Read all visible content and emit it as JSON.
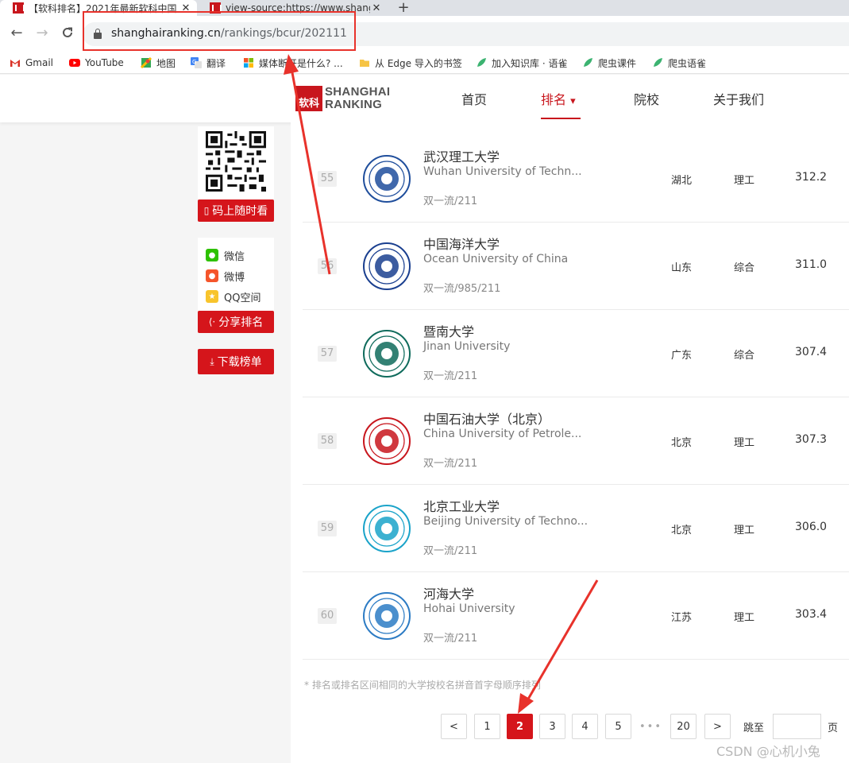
{
  "browser": {
    "tabs": [
      {
        "title": "【软科排名】2021年最新软科中国",
        "active": true
      },
      {
        "title": "view-source:https://www.shanghairanking.cn",
        "active": false
      }
    ],
    "new_tab_glyph": "+",
    "url_host": "shanghairanking.cn",
    "url_path": "/rankings/bcur/202111",
    "bookmarks": [
      "Gmail",
      "YouTube",
      "地图",
      "翻译",
      "媒体断开是什么? ...",
      "从 Edge 导入的书签",
      "加入知识库 · 语雀",
      "爬虫课件",
      "爬虫语雀"
    ]
  },
  "site": {
    "logo_mark": "软科",
    "logo_line1": "SHANGHAI",
    "logo_line2": "RANKING",
    "nav": [
      "首页",
      "排名",
      "院校",
      "关于我们"
    ],
    "nav_dropdown_glyph": "▾"
  },
  "sidebar": {
    "qr_button": "码上随时看",
    "share_items": [
      "微信",
      "微博",
      "QQ空间"
    ],
    "share_button": "分享排名",
    "download_button": "下载榜单"
  },
  "rankings": [
    {
      "rank": "55",
      "name_cn": "武汉理工大学",
      "name_en": "Wuhan University of Techn...",
      "tags": "双一流/211",
      "province": "湖北",
      "type": "理工",
      "score": "312.2",
      "emblem_color": "#1f4e9c"
    },
    {
      "rank": "56",
      "name_cn": "中国海洋大学",
      "name_en": "Ocean University of China",
      "tags": "双一流/985/211",
      "province": "山东",
      "type": "综合",
      "score": "311.0",
      "emblem_color": "#1a3f8f"
    },
    {
      "rank": "57",
      "name_cn": "暨南大学",
      "name_en": "Jinan University",
      "tags": "双一流/211",
      "province": "广东",
      "type": "综合",
      "score": "307.4",
      "emblem_color": "#0f6b5c"
    },
    {
      "rank": "58",
      "name_cn": "中国石油大学（北京）",
      "name_en": "China University of Petrole...",
      "tags": "双一流/211",
      "province": "北京",
      "type": "理工",
      "score": "307.3",
      "emblem_color": "#c8161d"
    },
    {
      "rank": "59",
      "name_cn": "北京工业大学",
      "name_en": "Beijing University of Techno...",
      "tags": "双一流/211",
      "province": "北京",
      "type": "理工",
      "score": "306.0",
      "emblem_color": "#1aa3c9"
    },
    {
      "rank": "60",
      "name_cn": "河海大学",
      "name_en": "Hohai University",
      "tags": "双一流/211",
      "province": "江苏",
      "type": "理工",
      "score": "303.4",
      "emblem_color": "#2c7bc4"
    }
  ],
  "footnote": "* 排名或排名区间相同的大学按校名拼音首字母顺序排列",
  "pagination": {
    "prev": "<",
    "pages": [
      "1",
      "2",
      "3",
      "4",
      "5"
    ],
    "ellipsis": "•••",
    "last": "20",
    "next": ">",
    "current": "2",
    "jump_label": "跳至",
    "jump_value": "",
    "suffix": "页"
  },
  "watermark": "CSDN @心机小兔",
  "colors": {
    "brand_red": "#d5151b",
    "annotation_red": "#e8322b"
  }
}
